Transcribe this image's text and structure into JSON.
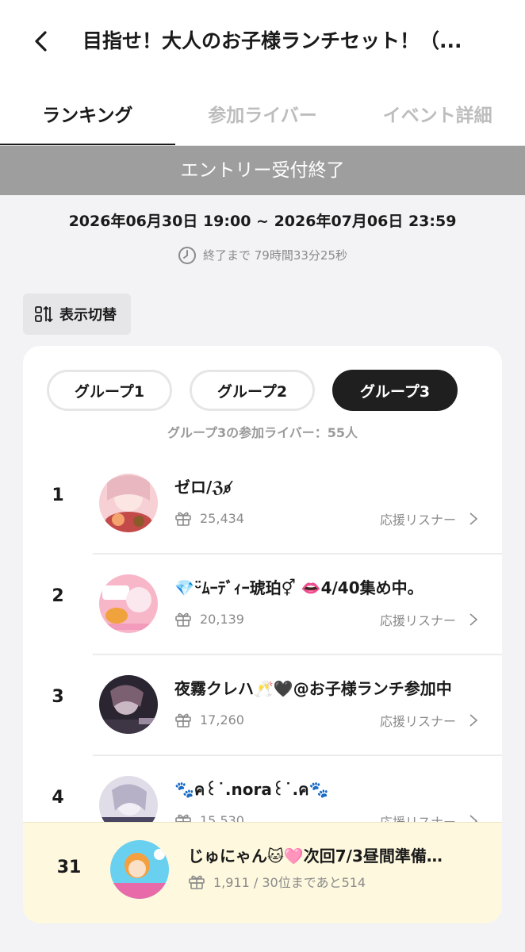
{
  "header": {
    "back_icon": "chevron-left-icon",
    "title": "目指せ！大人のお子様ランチセット！（..."
  },
  "tabs": [
    {
      "label": "ランキング",
      "active": true
    },
    {
      "label": "参加ライバー",
      "active": false
    },
    {
      "label": "イベント詳細",
      "active": false
    }
  ],
  "entry_status": "エントリー受付終了",
  "period": "2026年06月30日 19:00 ~ 2026年07月06日 23:59",
  "remaining": {
    "icon": "clock-icon",
    "text": "終了まで 79時間33分25秒"
  },
  "view_toggle": {
    "icon": "sort-toggle-icon",
    "label": "表示切替"
  },
  "groups": [
    {
      "label": "グループ1",
      "active": false
    },
    {
      "label": "グループ2",
      "active": false
    },
    {
      "label": "グループ3",
      "active": true
    }
  ],
  "group_count": "グループ3の参加ライバー：55人",
  "ranking": [
    {
      "rank": "1",
      "name": "ゼロ/ℨ𝔬̸",
      "points": "25,434",
      "supporters_label": "応援リスナー",
      "avatar_colors": [
        "#f6d0d4",
        "#c44a4a",
        "#f3a36b"
      ]
    },
    {
      "rank": "2",
      "name": "💎ᵕ̈ﾑｰﾃﾞｨｰ琥珀⚥ 👄4/40集め中。",
      "points": "20,139",
      "supporters_label": "応援リスナー",
      "avatar_colors": [
        "#f7b7c9",
        "#f0a23c",
        "#ffffff"
      ]
    },
    {
      "rank": "3",
      "name": "夜霧クレハ🥂🖤@お子様ランチ参加中",
      "points": "17,260",
      "supporters_label": "応援リスナー",
      "avatar_colors": [
        "#2a2530",
        "#7a6070",
        "#c9b8c4"
      ]
    },
    {
      "rank": "4",
      "name": "🐾ค꒰˙.nora꒰˙.ค🐾",
      "points": "15,530",
      "supporters_label": "応援リスナー",
      "avatar_colors": [
        "#e0dde8",
        "#8b84a0",
        "#4a4560"
      ]
    }
  ],
  "my_rank": {
    "rank": "31",
    "name": "じゅにゃん🐱🩷次回7/3昼間準備…",
    "points": "1,911 / 30位まであと514",
    "avatar_colors": [
      "#6ad0f0",
      "#e86aa8",
      "#f4a040"
    ]
  },
  "icons": {
    "gift": "gift-icon",
    "chevron_right": "chevron-right-icon"
  }
}
